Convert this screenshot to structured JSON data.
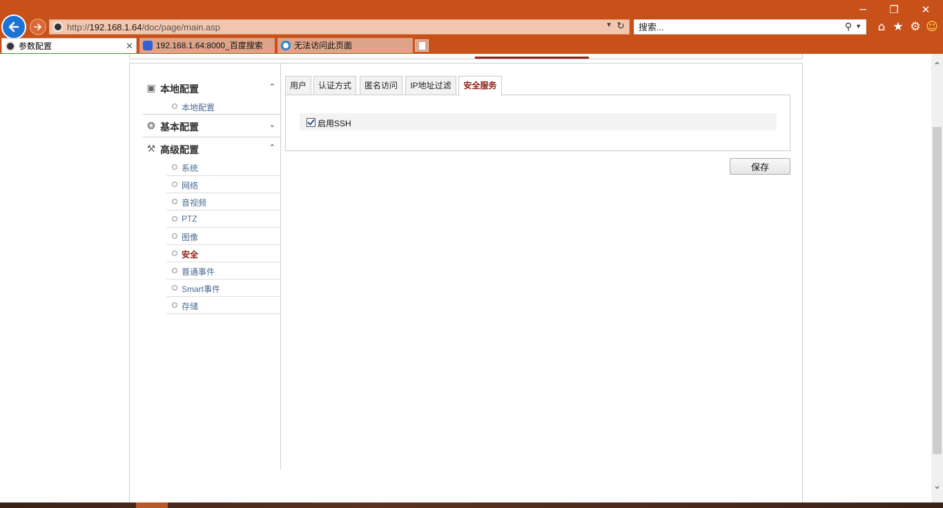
{
  "browser": {
    "address": {
      "prefix": "http://",
      "host": "192.168.1.64",
      "path": "/doc/page/main.asp"
    },
    "search_placeholder": "搜索...",
    "tabs": [
      {
        "label": "参数配置"
      },
      {
        "label": "192.168.1.64:8000_百度搜索"
      },
      {
        "label": "无法访问此页面"
      }
    ],
    "window_controls": {
      "minimize": "─",
      "restore": "❐",
      "close": "✕"
    },
    "toolbar_icons": [
      "home-icon",
      "favorites-star-icon",
      "settings-gear-icon",
      "feedback-smiley-icon"
    ]
  },
  "sidebar": {
    "groups": [
      {
        "label": "本地配置",
        "icon": "local-config-icon",
        "expanded": true,
        "items": [
          {
            "label": "本地配置",
            "active": false
          }
        ]
      },
      {
        "label": "基本配置",
        "icon": "basic-config-icon",
        "expanded": false,
        "items": []
      },
      {
        "label": "高级配置",
        "icon": "wrench-icon",
        "expanded": true,
        "items": [
          {
            "label": "系统",
            "active": false
          },
          {
            "label": "网络",
            "active": false
          },
          {
            "label": "音视频",
            "active": false
          },
          {
            "label": "PTZ",
            "active": false
          },
          {
            "label": "图像",
            "active": false
          },
          {
            "label": "安全",
            "active": true
          },
          {
            "label": "普通事件",
            "active": false
          },
          {
            "label": "Smart事件",
            "active": false
          },
          {
            "label": "存储",
            "active": false
          }
        ]
      }
    ]
  },
  "content": {
    "tabs": [
      {
        "label": "用户",
        "active": false
      },
      {
        "label": "认证方式",
        "active": false
      },
      {
        "label": "匿名访问",
        "active": false
      },
      {
        "label": "IP地址过滤",
        "active": false
      },
      {
        "label": "安全服务",
        "active": true
      }
    ],
    "ssh": {
      "label": "启用SSH",
      "checked": true
    },
    "save_label": "保存"
  },
  "colors": {
    "chrome": "#c8511a",
    "active_text": "#8b1a10",
    "link_text": "#4a6b94",
    "header_accent": "#9b1b1b"
  }
}
